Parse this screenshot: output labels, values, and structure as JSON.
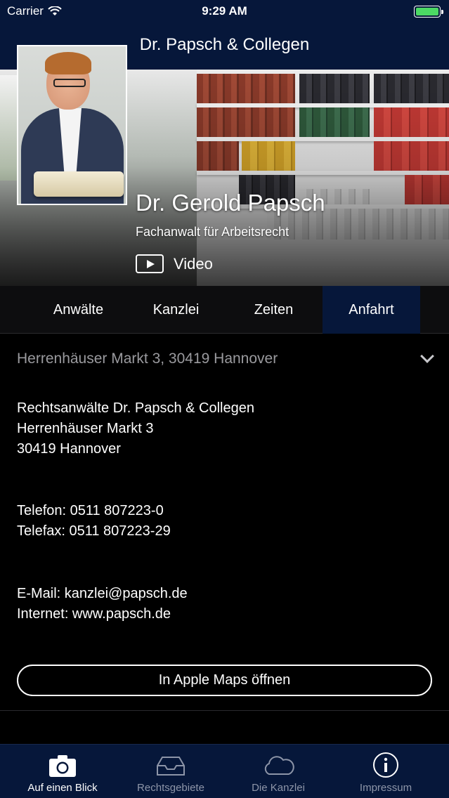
{
  "status_bar": {
    "carrier": "Carrier",
    "time": "9:29 AM"
  },
  "nav": {
    "title": "Dr. Papsch & Collegen"
  },
  "profile": {
    "name": "Dr. Gerold Papsch",
    "subtitle": "Fachanwalt für Arbeitsrecht",
    "video_label": "Video"
  },
  "tabs": [
    {
      "label": "Anwälte",
      "active": false
    },
    {
      "label": "Kanzlei",
      "active": false
    },
    {
      "label": "Zeiten",
      "active": false
    },
    {
      "label": "Anfahrt",
      "active": true
    }
  ],
  "address_header": "Herrenhäuser Markt 3, 30419 Hannover",
  "contact": {
    "firm": "Rechtsanwälte Dr. Papsch & Collegen",
    "street": "Herrenhäuser Markt 3",
    "city": "30419 Hannover",
    "phone": "Telefon: 0511 807223-0",
    "fax": "Telefax: 0511 807223-29",
    "email": "E-Mail: kanzlei@papsch.de",
    "web": "Internet: www.papsch.de"
  },
  "maps_button": "In Apple Maps öffnen",
  "tabbar": [
    {
      "label": "Auf einen Blick",
      "icon": "camera-icon",
      "active": true
    },
    {
      "label": "Rechtsgebiete",
      "icon": "inbox-icon",
      "active": false
    },
    {
      "label": "Die Kanzlei",
      "icon": "cloud-icon",
      "active": false
    },
    {
      "label": "Impressum",
      "icon": "info-icon",
      "active": false
    }
  ],
  "colors": {
    "nav_bg": "#06173a",
    "active_tab": "#06173a",
    "battery": "#4cd964"
  }
}
